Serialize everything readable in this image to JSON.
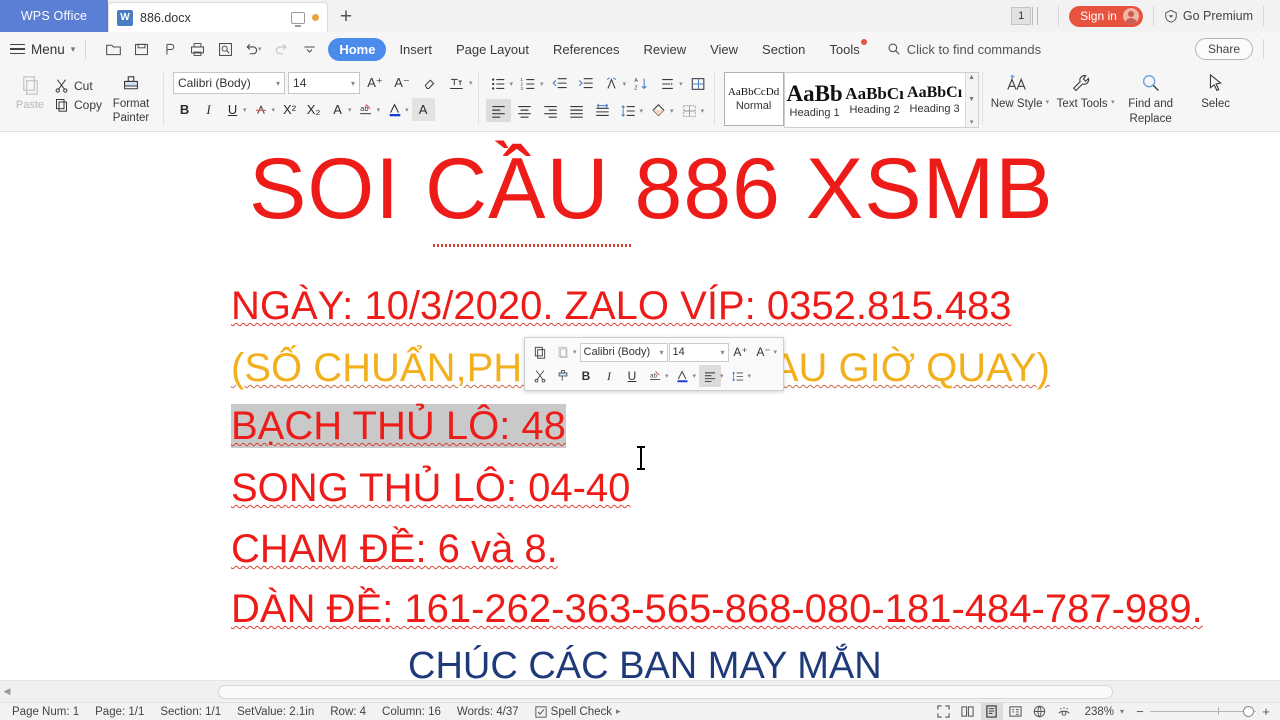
{
  "titlebar": {
    "app_name": "WPS Office",
    "tab": {
      "label": "886.docx",
      "icon": "word-doc-icon",
      "modified_dot": "unsaved-indicator"
    },
    "new_tab_label": "+",
    "window_count": "1",
    "sign_in_label": "Sign in",
    "premium_label": "Go Premium"
  },
  "menubar": {
    "menu_label": "Menu",
    "quick_access": [
      "open-icon",
      "save-icon",
      "touch-mode-icon",
      "print-icon",
      "print-preview-icon",
      "undo-icon",
      "redo-icon",
      "customize-icon"
    ],
    "tabs": [
      {
        "label": "Home",
        "active": true
      },
      {
        "label": "Insert",
        "active": false
      },
      {
        "label": "Page Layout",
        "active": false
      },
      {
        "label": "References",
        "active": false
      },
      {
        "label": "Review",
        "active": false
      },
      {
        "label": "View",
        "active": false
      },
      {
        "label": "Section",
        "active": false
      },
      {
        "label": "Tools",
        "active": false,
        "badge": true
      }
    ],
    "find_commands": "Click to find commands",
    "share_label": "Share"
  },
  "ribbon": {
    "paste_label": "Paste",
    "cut_label": "Cut",
    "copy_label": "Copy",
    "format_painter_line1": "Format",
    "format_painter_line2": "Painter",
    "font_name": "Calibri (Body)",
    "font_size": "14",
    "styles": [
      {
        "sample": "AaBbCcDd",
        "label": "Normal",
        "selected": true
      },
      {
        "sample": "AaBb",
        "label": "Heading 1",
        "selected": false
      },
      {
        "sample": "AaBbCı",
        "label": "Heading 2",
        "selected": false
      },
      {
        "sample": "AaBbCı",
        "label": "Heading 3",
        "selected": false
      }
    ],
    "new_style_label": "New Style",
    "text_tools_label": "Text Tools",
    "find_replace_line1": "Find and",
    "find_replace_line2": "Replace",
    "select_label": "Selec"
  },
  "minibar": {
    "font_name": "Calibri (Body)",
    "font_size": "14",
    "row1_icons": [
      "copy-icon",
      "paste-icon",
      "grow-font-icon",
      "shrink-font-icon"
    ],
    "row2_icons": [
      "cut-icon",
      "format-painter-icon",
      "bold-icon",
      "italic-icon",
      "underline-icon",
      "highlight-icon",
      "font-color-icon",
      "align-icon",
      "line-spacing-icon"
    ],
    "bold_label": "B",
    "italic_label": "I",
    "underline_label": "U",
    "grow_label": "A",
    "shrink_label": "A"
  },
  "document": {
    "lines": [
      {
        "id": "title",
        "text": "SOI CẦU 886 XSMB",
        "color": "#ee1c18",
        "size": 86,
        "align": "center"
      },
      {
        "id": "ngay",
        "text": "NGÀY: 10/3/2020. ZALO VÍP: 0352.815.483",
        "color": "#ee1c18",
        "size": 40,
        "align": "left"
      },
      {
        "id": "sochuan",
        "text": "(SỐ CHUẨN,PHÍ THẤP, PHÍ SAU GIỜ QUAY)",
        "color": "#f2b01e",
        "size": 40,
        "align": "left"
      },
      {
        "id": "bachthu",
        "text": "BẠCH THỦ LÔ: 48",
        "color": "#ee1c18",
        "size": 40,
        "align": "left",
        "selected": true
      },
      {
        "id": "songthu",
        "text": "SONG THỦ LÔ: 04-40",
        "color": "#ee1c18",
        "size": 40,
        "align": "left"
      },
      {
        "id": "chamde",
        "text": "CHAM ĐỀ: 6 và 8.",
        "color": "#ee1c18",
        "size": 40,
        "align": "left"
      },
      {
        "id": "dande",
        "text": "DÀN ĐỀ: 161-262-363-565-868-080-181-484-787-989.",
        "color": "#ee1c18",
        "size": 40,
        "align": "left"
      },
      {
        "id": "chuc",
        "text": "CHÚC CÁC BẠN MAY MẮN",
        "color": "#1f3a7a",
        "size": 38,
        "align": "center"
      }
    ],
    "colors": {
      "red": "#ee1c18",
      "gold": "#f2b01e",
      "navy": "#1f3a7a",
      "selection": "#c9c9c9",
      "spellcheck_underline": "#d94030"
    }
  },
  "statusbar": {
    "items": [
      "Page Num: 1",
      "Page: 1/1",
      "Section: 1/1",
      "SetValue: 2.1in",
      "Row: 4",
      "Column: 16",
      "Words: 4/37"
    ],
    "spell_check_label": "Spell Check",
    "view_icons": [
      "fullscreen-icon",
      "two-page-icon",
      "print-layout-icon",
      "outline-icon",
      "web-layout-icon",
      "eye-protect-icon"
    ],
    "zoom_level": "238%"
  }
}
